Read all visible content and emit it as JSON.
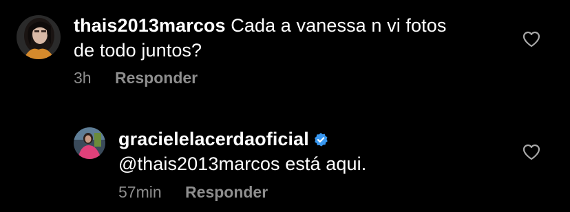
{
  "comments": [
    {
      "username": "thais2013marcos",
      "text_line1": "Cada a vanessa  n vi fotos",
      "text_line2": "de todo juntos?",
      "time": "3h",
      "reply_label": "Responder",
      "verified": false
    },
    {
      "username": "gracielelacerdaoficial",
      "text_line1": "@thais2013marcos está aqui.",
      "time": "57min",
      "reply_label": "Responder",
      "verified": true
    }
  ],
  "icons": {
    "like": "heart-outline-icon",
    "verified": "verified-badge-icon"
  },
  "colors": {
    "background": "#000000",
    "text": "#ffffff",
    "meta": "#8e8e8e",
    "verified": "#3897f0"
  }
}
